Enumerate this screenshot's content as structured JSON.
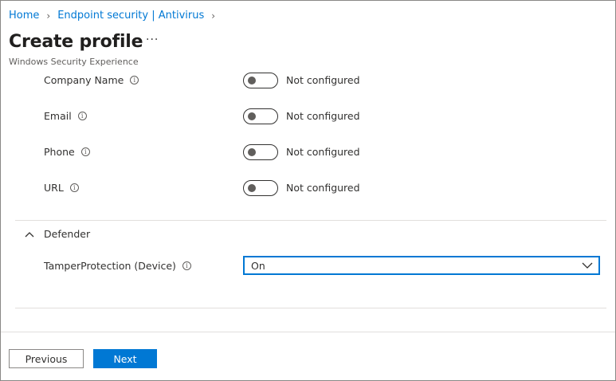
{
  "breadcrumb": {
    "items": [
      "Home",
      "Endpoint security | Antivirus"
    ]
  },
  "page": {
    "title": "Create profile",
    "more_label": "···",
    "subtitle": "Windows Security Experience"
  },
  "settings": [
    {
      "label": "Company Name",
      "state": "Not configured",
      "enabled": false
    },
    {
      "label": "Email",
      "state": "Not configured",
      "enabled": false
    },
    {
      "label": "Phone",
      "state": "Not configured",
      "enabled": false
    },
    {
      "label": "URL",
      "state": "Not configured",
      "enabled": false
    }
  ],
  "defender": {
    "section_title": "Defender",
    "expanded": true,
    "tamper_label": "TamperProtection (Device)",
    "tamper_value": "On"
  },
  "footer": {
    "previous_label": "Previous",
    "next_label": "Next"
  },
  "colors": {
    "accent": "#0078d4",
    "text": "#323130",
    "divider": "#e1dfdd"
  },
  "icons": {
    "info": "info-icon",
    "breadcrumb_separator": "chevron-right-icon",
    "section_toggle": "chevron-up-icon",
    "dropdown": "chevron-down-icon"
  }
}
